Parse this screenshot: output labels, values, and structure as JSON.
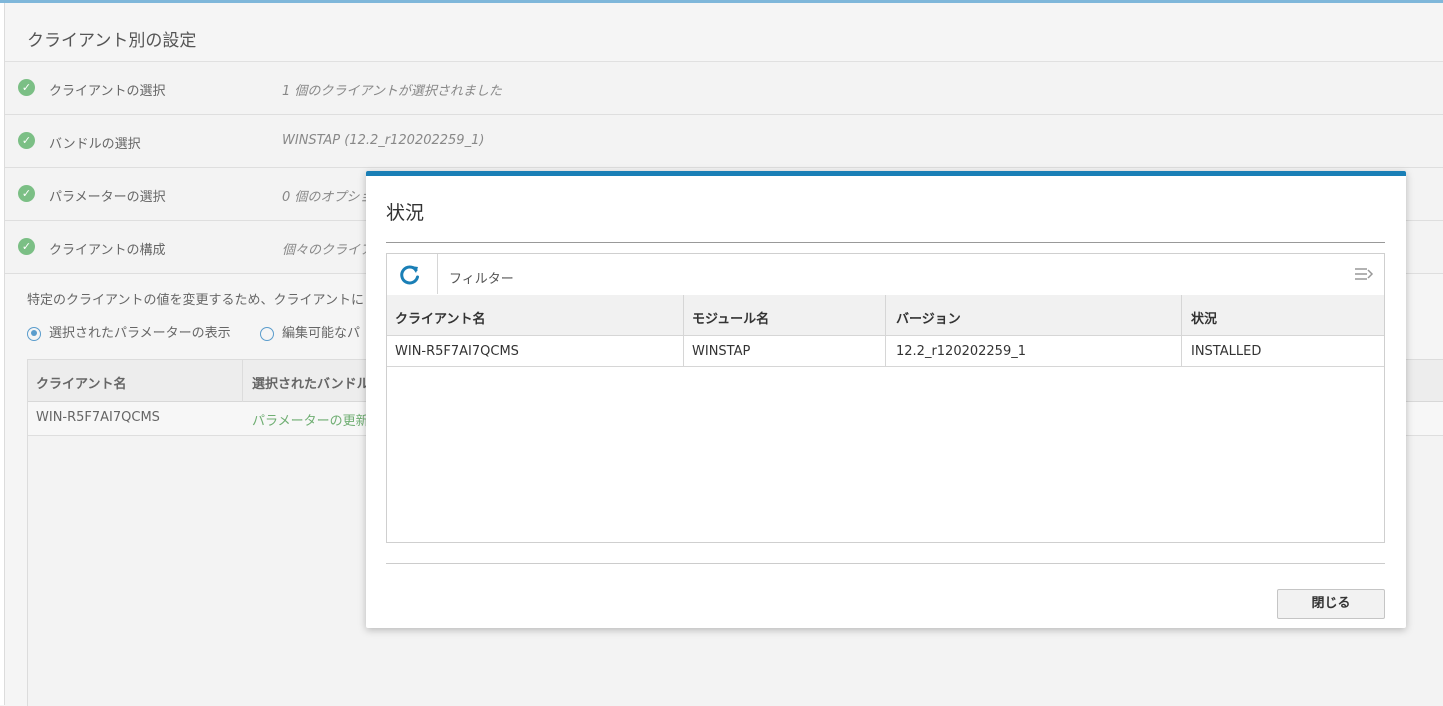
{
  "page": {
    "title": "クライアント別の設定"
  },
  "steps": [
    {
      "label": "クライアントの選択",
      "value": "1 個のクライアントが選択されました"
    },
    {
      "label": "バンドルの選択",
      "value": "WINSTAP (12.2_r120202259_1)"
    },
    {
      "label": "パラメーターの選択",
      "value": "0 個のオプショ"
    },
    {
      "label": "クライアントの構成",
      "value": "個々のクライア"
    }
  ],
  "description": "特定のクライアントの値を変更するため、クライアントに",
  "view_options": {
    "selected": "選択されたパラメーターの表示",
    "editable": "編集可能なパ"
  },
  "bg_table": {
    "columns": [
      "クライアント名",
      "選択されたバンドル"
    ],
    "rows": [
      {
        "client": "WIN-R5F7AI7QCMS",
        "action": "パラメーターの更新"
      }
    ]
  },
  "modal": {
    "title": "状況",
    "filter_label": "フィルター",
    "columns": [
      "クライアント名",
      "モジュール名",
      "バージョン",
      "状況"
    ],
    "rows": [
      [
        "WIN-R5F7AI7QCMS",
        "WINSTAP",
        "12.2_r120202259_1",
        "INSTALLED"
      ]
    ],
    "close_label": "閉じる"
  },
  "colors": {
    "accent": "#1a7fb6",
    "success": "#7bbf85",
    "link_green": "#6fae72"
  },
  "icons": {
    "check": "check-circle-icon",
    "refresh": "refresh-icon",
    "columns": "columns-icon"
  }
}
